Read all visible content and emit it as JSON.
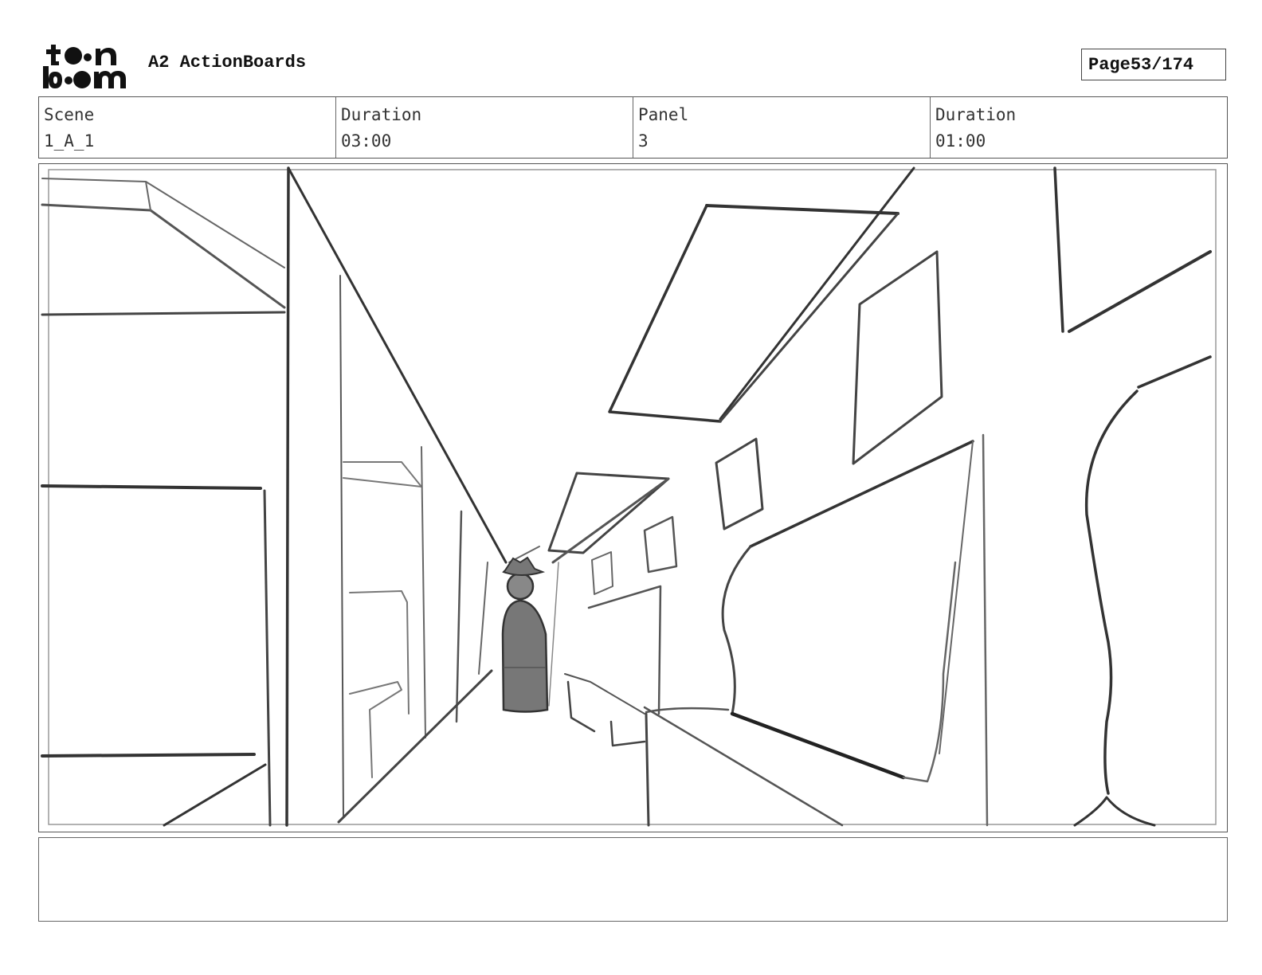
{
  "header": {
    "logo_top": "to•n",
    "logo_bottom": "b•om",
    "project_title": "A2 ActionBoards",
    "page_label": "Page",
    "page_value": "53/174"
  },
  "info": [
    {
      "label": "Scene",
      "value": "1_A_1"
    },
    {
      "label": "Duration",
      "value": "03:00"
    },
    {
      "label": "Panel",
      "value": "3"
    },
    {
      "label": "Duration",
      "value": "01:00"
    }
  ],
  "notes": {
    "text": ""
  }
}
